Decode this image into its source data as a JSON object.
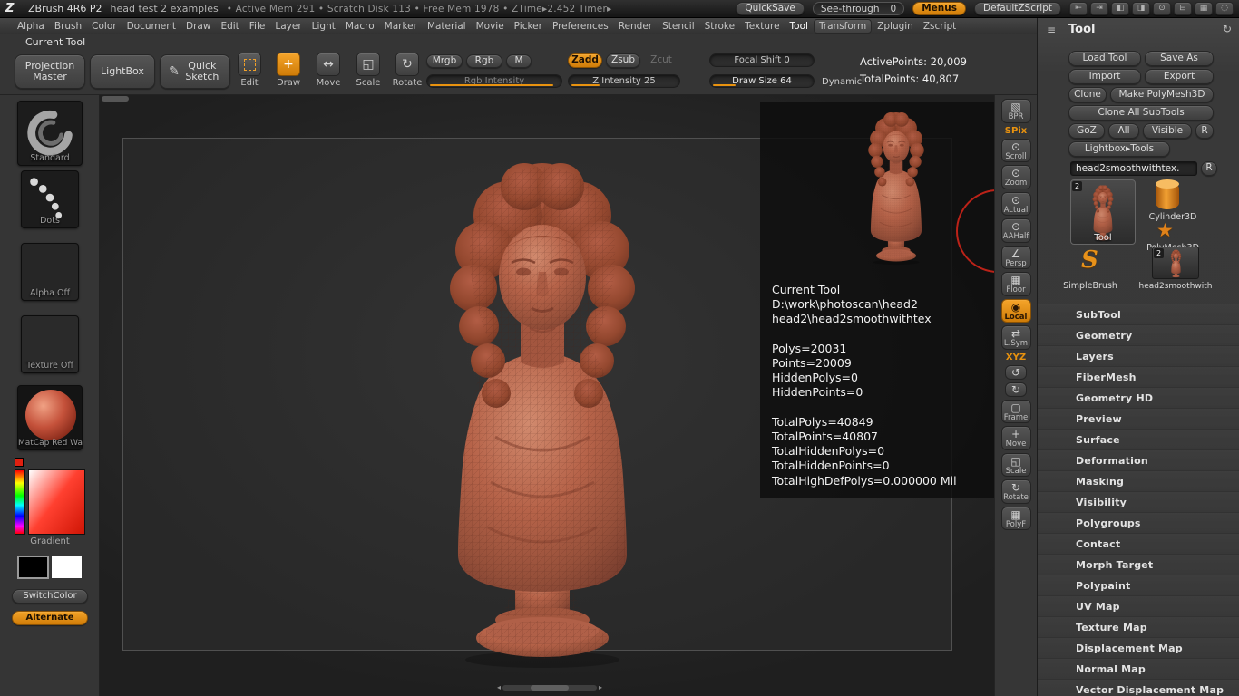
{
  "colors": {
    "accent": "#e8920f",
    "model_clay": "#b15f48",
    "ring_red": "#bb2218"
  },
  "icons": {
    "logo": "Z",
    "quick_sketch": "✎",
    "panel_menu": "≡",
    "panel_refresh": "↻",
    "polymesh_star": "★",
    "simplebrush_s": "S",
    "scroll_left": "◂",
    "scroll_right": "▸"
  },
  "titlebar": {
    "app_title": "ZBrush 4R6 P2",
    "doc_title": "head test 2 examples",
    "stats": "• Active Mem 291  • Scratch Disk 113  • Free Mem 1978  • ZTime▸2.452 Timer▸",
    "quicksave": "QuickSave",
    "seethrough": "See-through",
    "seethrough_value": "0",
    "menus": "Menus",
    "default_zscript": "DefaultZScript",
    "window_icons": [
      "⇤",
      "⇥",
      "◧",
      "◨",
      "⊙",
      "⊟",
      "▦",
      "◌"
    ]
  },
  "menubar": [
    {
      "label": "Alpha"
    },
    {
      "label": "Brush"
    },
    {
      "label": "Color"
    },
    {
      "label": "Document"
    },
    {
      "label": "Draw"
    },
    {
      "label": "Edit"
    },
    {
      "label": "File"
    },
    {
      "label": "Layer"
    },
    {
      "label": "Light"
    },
    {
      "label": "Macro"
    },
    {
      "label": "Marker"
    },
    {
      "label": "Material"
    },
    {
      "label": "Movie"
    },
    {
      "label": "Picker"
    },
    {
      "label": "Preferences"
    },
    {
      "label": "Render"
    },
    {
      "label": "Stencil"
    },
    {
      "label": "Stroke"
    },
    {
      "label": "Texture"
    },
    {
      "label": "Tool",
      "cls": "hl"
    },
    {
      "label": "Transform",
      "cls": "raised"
    },
    {
      "label": "Zplugin"
    },
    {
      "label": "Zscript"
    }
  ],
  "shelf": {
    "current_tool_header": "Current Tool",
    "projection_master": "Projection Master",
    "lightbox": "LightBox",
    "quick_sketch": "Quick Sketch",
    "edit": "Edit",
    "draw": "Draw",
    "move": "Move",
    "scale": "Scale",
    "rotate": "Rotate",
    "mrgb": "Mrgb",
    "rgb": "Rgb",
    "m": "M",
    "rgb_intensity": "Rgb Intensity",
    "zadd": "Zadd",
    "zsub": "Zsub",
    "zcut": "Zcut",
    "z_intensity": "Z Intensity 25",
    "focal_shift": "Focal Shift 0",
    "draw_size": "Draw Size 64",
    "dynamic": "Dynamic",
    "active_points": "ActivePoints: 20,009",
    "total_points": "TotalPoints: 40,807"
  },
  "sidebar": {
    "standard": "Standard",
    "dots": "Dots",
    "alpha_off": "Alpha Off",
    "texture_off": "Texture Off",
    "matcap": "MatCap Red Wa",
    "gradient": "Gradient",
    "switch_color": "SwitchColor",
    "alternate": "Alternate"
  },
  "right_strip": {
    "items": [
      {
        "label": "BPR",
        "glyph": "▧"
      },
      {
        "label": "SPix",
        "glyph": "",
        "cls": "txt-orange"
      },
      {
        "label": "Scroll",
        "glyph": "⊙"
      },
      {
        "label": "Zoom",
        "glyph": "⊙"
      },
      {
        "label": "Actual",
        "glyph": "⊙"
      },
      {
        "label": "AAHalf",
        "glyph": "⊙"
      },
      {
        "label": "Persp",
        "glyph": "∠"
      },
      {
        "label": "Floor",
        "glyph": "▦"
      },
      {
        "label": "Local",
        "glyph": "◉",
        "cls": "active"
      },
      {
        "label": "L.Sym",
        "glyph": "⇄"
      },
      {
        "label": "XYZ",
        "glyph": "",
        "cls": "txt-orange"
      },
      {
        "label": "",
        "glyph": "↺",
        "cls": "mini"
      },
      {
        "label": "",
        "glyph": "↻",
        "cls": "mini"
      },
      {
        "label": "Frame",
        "glyph": "▢"
      },
      {
        "label": "Move",
        "glyph": "+"
      },
      {
        "label": "Scale",
        "glyph": "◱"
      },
      {
        "label": "Rotate",
        "glyph": "↻"
      },
      {
        "label": "PolyF",
        "glyph": "▦"
      }
    ]
  },
  "tool_panel": {
    "title": "Tool",
    "load_tool": "Load Tool",
    "save_as": "Save As",
    "import": "Import",
    "export": "Export",
    "clone": "Clone",
    "make_polymesh": "Make PolyMesh3D",
    "clone_all_subtools": "Clone All SubTools",
    "goz": "GoZ",
    "all": "All",
    "visible": "Visible",
    "r": "R",
    "lightbox_tools": "Lightbox▸Tools",
    "active_tool_name": "head2smoothwithtex.",
    "rename_r": "R",
    "current_tool_label": "Tool",
    "current_tool_badge": "2",
    "thumb_cylinder": "Cylinder3D",
    "thumb_polymesh": "PolyMesh3D",
    "thumb_simplebrush": "SimpleBrush",
    "thumb_head2": "head2smoothwith",
    "thumb_head2_badge": "2",
    "sections": [
      "SubTool",
      "Geometry",
      "Layers",
      "FiberMesh",
      "Geometry HD",
      "Preview",
      "Surface",
      "Deformation",
      "Masking",
      "Visibility",
      "Polygroups",
      "Contact",
      "Morph Target",
      "Polypaint",
      "UV Map",
      "Texture Map",
      "Displacement Map",
      "Normal Map",
      "Vector Displacement Map"
    ]
  },
  "popup": {
    "lines": [
      "Current Tool",
      "D:\\work\\photoscan\\head2",
      "head2\\head2smoothwithtex",
      "",
      "Polys=20031",
      "Points=20009",
      "HiddenPolys=0",
      "HiddenPoints=0",
      "",
      "TotalPolys=40849",
      "TotalPoints=40807",
      "TotalHiddenPolys=0",
      "TotalHiddenPoints=0",
      "TotalHighDefPolys=0.000000 Mil"
    ]
  }
}
